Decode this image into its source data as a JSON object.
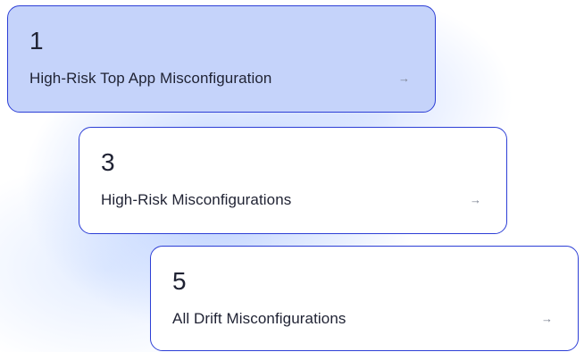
{
  "cards": [
    {
      "count": "1",
      "label": "High-Risk Top App Misconfiguration",
      "arrow": "→"
    },
    {
      "count": "3",
      "label": "High-Risk Misconfigurations",
      "arrow": "→"
    },
    {
      "count": "5",
      "label": "All Drift Misconfigurations",
      "arrow": "→"
    }
  ],
  "colors": {
    "accent_border": "#2d3fd6",
    "active_card_bg": "#c5d3fa",
    "text": "#1f2233",
    "arrow": "#7a7f8f"
  },
  "icons": {
    "arrow": "arrow-right-icon"
  }
}
